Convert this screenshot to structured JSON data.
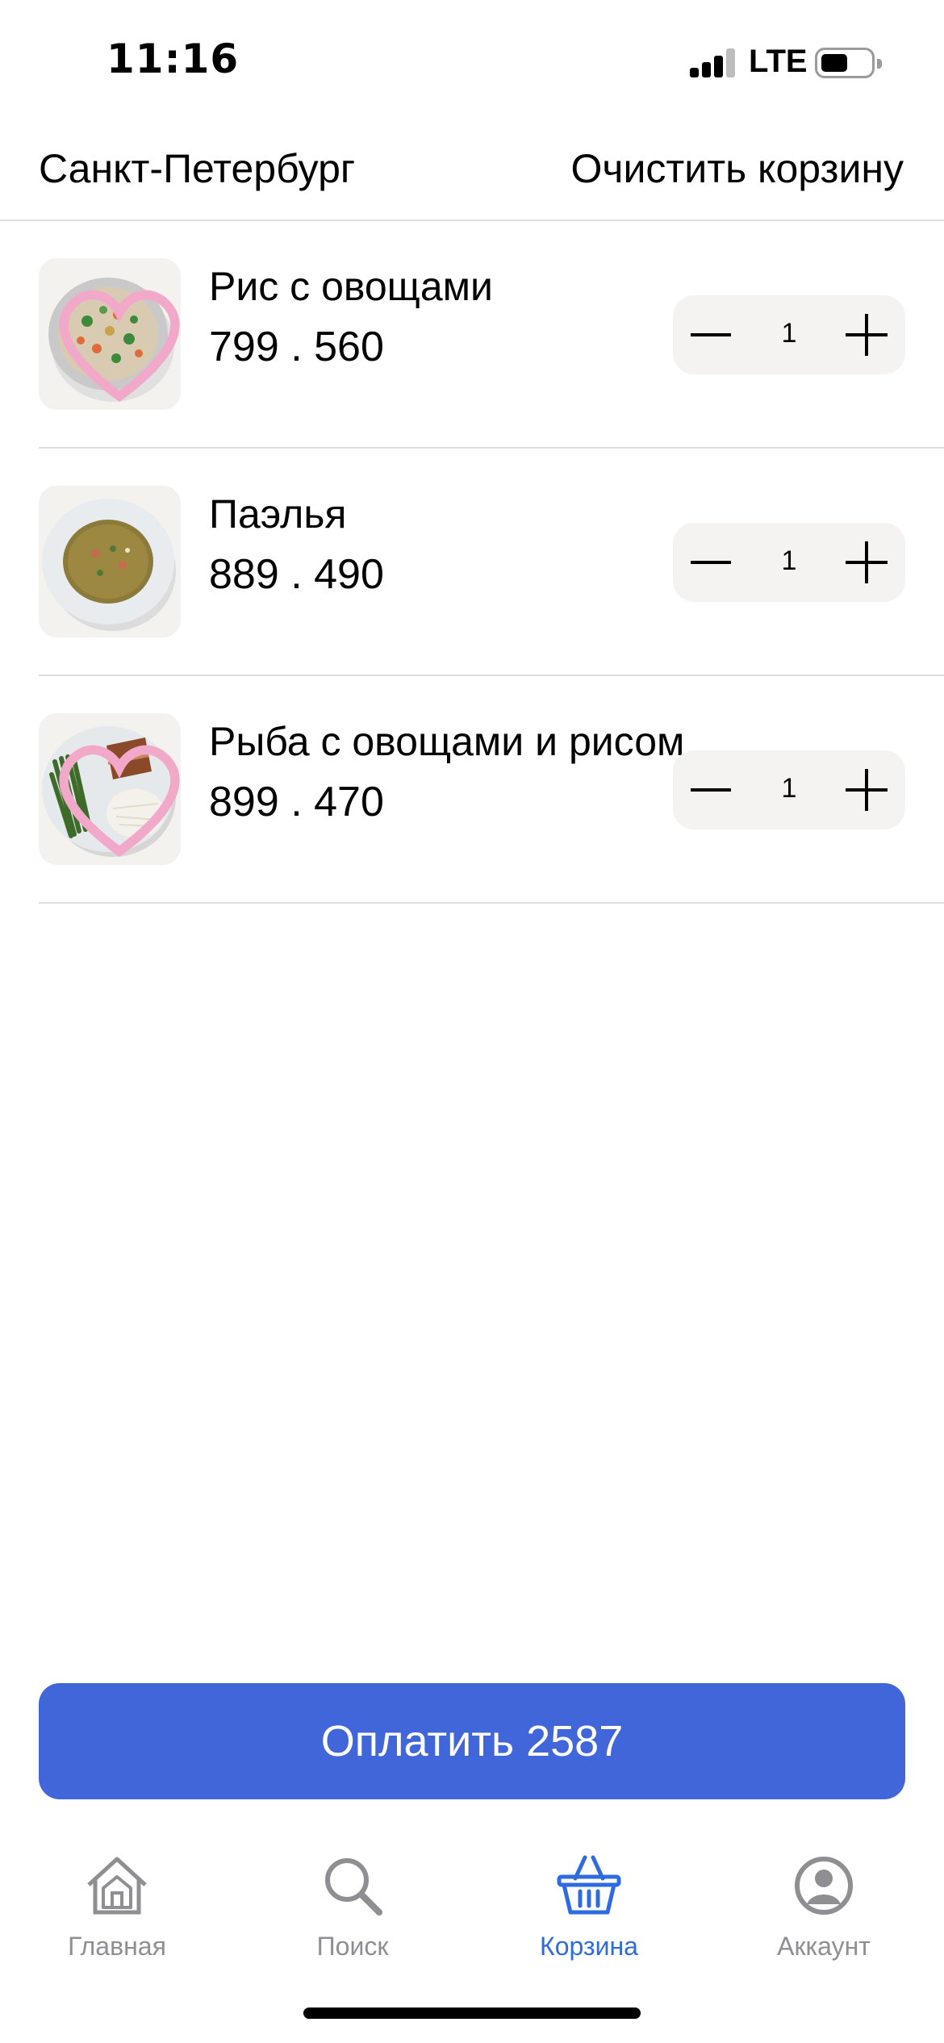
{
  "status_bar": {
    "time": "11:16",
    "network": "LTE",
    "signal_bars": 3,
    "battery_level": 0.55
  },
  "header": {
    "city": "Санкт-Петербург",
    "clear_cart_label": "Очистить корзину"
  },
  "cart": {
    "items": [
      {
        "name": "Рис с овощами",
        "price": "799 . 560",
        "quantity": "1",
        "favorite_icon": "heart-icon",
        "image": "rice-with-vegetables-photo"
      },
      {
        "name": "Паэлья",
        "price": "889 . 490",
        "quantity": "1",
        "favorite_icon": "",
        "image": "paella-soup-photo"
      },
      {
        "name": "Рыба с овощами и рисом",
        "price": "899 . 470",
        "quantity": "1",
        "favorite_icon": "heart-icon",
        "image": "fish-vegetables-rice-photo"
      }
    ]
  },
  "pay_button": {
    "label": "Оплатить 2587"
  },
  "tab_bar": {
    "tabs": [
      {
        "label": "Главная",
        "icon": "home-icon",
        "active": false
      },
      {
        "label": "Поиск",
        "icon": "search-icon",
        "active": false
      },
      {
        "label": "Корзина",
        "icon": "basket-icon",
        "active": true
      },
      {
        "label": "Аккаунт",
        "icon": "account-icon",
        "active": false
      }
    ]
  },
  "colors": {
    "accent": "#4166d9",
    "tab_active": "#2f6be0",
    "tab_inactive": "#8e8e93",
    "stepper_bg": "#f4f3f1"
  }
}
